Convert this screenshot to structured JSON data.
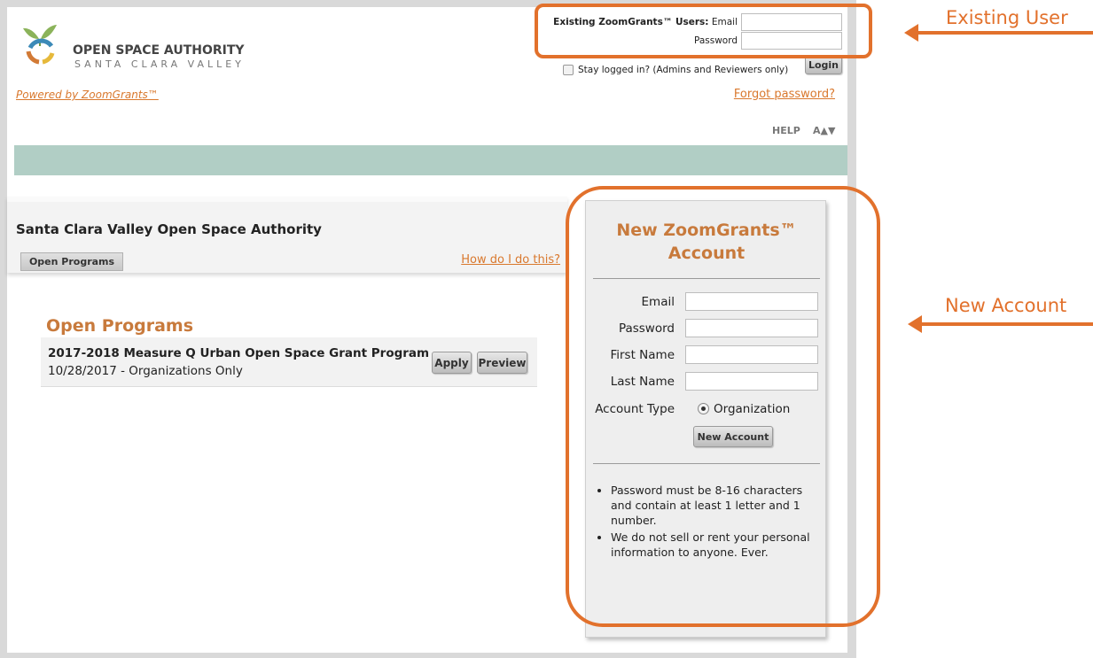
{
  "logo": {
    "name": "OPEN SPACE AUTHORITY",
    "subname": "SANTA CLARA VALLEY",
    "powered_by": "Powered by ZoomGrants™"
  },
  "login": {
    "heading_bold": "Existing ZoomGrants™ Users:",
    "email_label": "Email",
    "password_label": "Password",
    "stay_logged_in": "Stay logged in? (Admins and Reviewers only)",
    "login_button": "Login",
    "forgot_password": "Forgot password?"
  },
  "toolbar": {
    "help": "HELP",
    "font_size": "A▲▼"
  },
  "org": {
    "title": "Santa Clara Valley Open Space Authority",
    "tab": "Open Programs",
    "how_do_i": "How do I do this?"
  },
  "programs": {
    "heading": "Open Programs",
    "items": [
      {
        "name": "2017-2018 Measure Q Urban Open Space Grant Program",
        "date_line": "10/28/2017 - Organizations Only",
        "apply": "Apply",
        "preview": "Preview"
      }
    ]
  },
  "new_account": {
    "title_line1": "New ZoomGrants™",
    "title_line2": "Account",
    "email_label": "Email",
    "password_label": "Password",
    "first_name_label": "First Name",
    "last_name_label": "Last Name",
    "account_type_label": "Account Type",
    "account_type_option": "Organization",
    "button": "New Account",
    "notes": [
      "Password must be 8-16 characters and contain at least 1 letter and 1 number.",
      "We do not sell or rent your personal information to anyone. Ever."
    ]
  },
  "annotations": {
    "existing_user": "Existing User",
    "new_account": "New Account",
    "color": "#e2712c"
  },
  "colors": {
    "accent_orange": "#c87a3c",
    "link_orange": "#d9782d",
    "teal_bar": "#b1cec5"
  }
}
